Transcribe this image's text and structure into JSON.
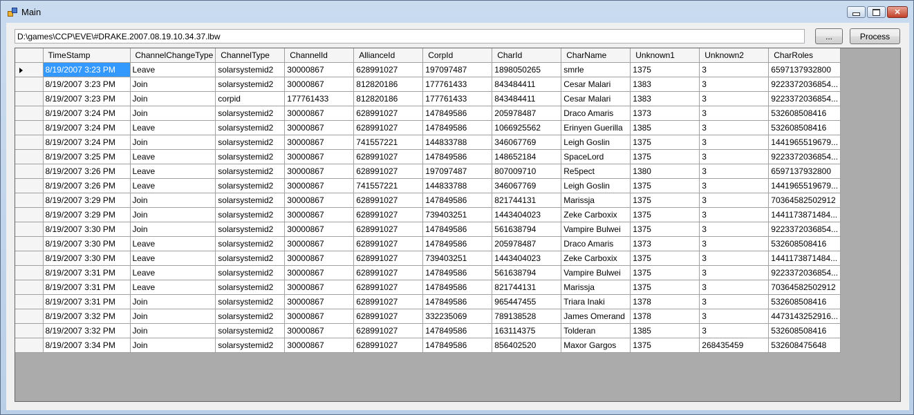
{
  "window": {
    "title": "Main"
  },
  "toolbar": {
    "path_value": "D:\\games\\CCP\\EVE\\#DRAKE.2007.08.19.10.34.37.lbw",
    "browse_label": "...",
    "process_label": "Process"
  },
  "grid": {
    "columns": [
      "TimeStamp",
      "ChannelChangeType",
      "ChannelType",
      "ChannelId",
      "AllianceId",
      "CorpId",
      "CharId",
      "CharName",
      "Unknown1",
      "Unknown2",
      "CharRoles"
    ],
    "rows": [
      [
        "8/19/2007 3:23 PM",
        "Leave",
        "solarsystemid2",
        "30000867",
        "628991027",
        "197097487",
        "1898050265",
        "smrle",
        "1375",
        "3",
        "6597137932800"
      ],
      [
        "8/19/2007 3:23 PM",
        "Join",
        "solarsystemid2",
        "30000867",
        "812820186",
        "177761433",
        "843484411",
        "Cesar Malari",
        "1383",
        "3",
        "9223372036854..."
      ],
      [
        "8/19/2007 3:23 PM",
        "Join",
        "corpid",
        "177761433",
        "812820186",
        "177761433",
        "843484411",
        "Cesar Malari",
        "1383",
        "3",
        "9223372036854..."
      ],
      [
        "8/19/2007 3:24 PM",
        "Join",
        "solarsystemid2",
        "30000867",
        "628991027",
        "147849586",
        "205978487",
        "Draco Amaris",
        "1373",
        "3",
        "532608508416"
      ],
      [
        "8/19/2007 3:24 PM",
        "Leave",
        "solarsystemid2",
        "30000867",
        "628991027",
        "147849586",
        "1066925562",
        "Erinyen Guerilla",
        "1385",
        "3",
        "532608508416"
      ],
      [
        "8/19/2007 3:24 PM",
        "Join",
        "solarsystemid2",
        "30000867",
        "741557221",
        "144833788",
        "346067769",
        "Leigh Goslin",
        "1375",
        "3",
        "1441965519679..."
      ],
      [
        "8/19/2007 3:25 PM",
        "Leave",
        "solarsystemid2",
        "30000867",
        "628991027",
        "147849586",
        "148652184",
        "SpaceLord",
        "1375",
        "3",
        "9223372036854..."
      ],
      [
        "8/19/2007 3:26 PM",
        "Leave",
        "solarsystemid2",
        "30000867",
        "628991027",
        "197097487",
        "807009710",
        "Re5pect",
        "1380",
        "3",
        "6597137932800"
      ],
      [
        "8/19/2007 3:26 PM",
        "Leave",
        "solarsystemid2",
        "30000867",
        "741557221",
        "144833788",
        "346067769",
        "Leigh Goslin",
        "1375",
        "3",
        "1441965519679..."
      ],
      [
        "8/19/2007 3:29 PM",
        "Join",
        "solarsystemid2",
        "30000867",
        "628991027",
        "147849586",
        "821744131",
        "Marissja",
        "1375",
        "3",
        "70364582502912"
      ],
      [
        "8/19/2007 3:29 PM",
        "Join",
        "solarsystemid2",
        "30000867",
        "628991027",
        "739403251",
        "1443404023",
        "Zeke Carboxix",
        "1375",
        "3",
        "1441173871484..."
      ],
      [
        "8/19/2007 3:30 PM",
        "Join",
        "solarsystemid2",
        "30000867",
        "628991027",
        "147849586",
        "561638794",
        "Vampire Bulwei",
        "1375",
        "3",
        "9223372036854..."
      ],
      [
        "8/19/2007 3:30 PM",
        "Leave",
        "solarsystemid2",
        "30000867",
        "628991027",
        "147849586",
        "205978487",
        "Draco Amaris",
        "1373",
        "3",
        "532608508416"
      ],
      [
        "8/19/2007 3:30 PM",
        "Leave",
        "solarsystemid2",
        "30000867",
        "628991027",
        "739403251",
        "1443404023",
        "Zeke Carboxix",
        "1375",
        "3",
        "1441173871484..."
      ],
      [
        "8/19/2007 3:31 PM",
        "Leave",
        "solarsystemid2",
        "30000867",
        "628991027",
        "147849586",
        "561638794",
        "Vampire Bulwei",
        "1375",
        "3",
        "9223372036854..."
      ],
      [
        "8/19/2007 3:31 PM",
        "Leave",
        "solarsystemid2",
        "30000867",
        "628991027",
        "147849586",
        "821744131",
        "Marissja",
        "1375",
        "3",
        "70364582502912"
      ],
      [
        "8/19/2007 3:31 PM",
        "Join",
        "solarsystemid2",
        "30000867",
        "628991027",
        "147849586",
        "965447455",
        "Triara Inaki",
        "1378",
        "3",
        "532608508416"
      ],
      [
        "8/19/2007 3:32 PM",
        "Join",
        "solarsystemid2",
        "30000867",
        "628991027",
        "332235069",
        "789138528",
        "James Omerand",
        "1378",
        "3",
        "4473143252916..."
      ],
      [
        "8/19/2007 3:32 PM",
        "Join",
        "solarsystemid2",
        "30000867",
        "628991027",
        "147849586",
        "163114375",
        "Tolderan",
        "1385",
        "3",
        "532608508416"
      ],
      [
        "8/19/2007 3:34 PM",
        "Join",
        "solarsystemid2",
        "30000867",
        "628991027",
        "147849586",
        "856402520",
        "Maxor Gargos",
        "1375",
        "268435459",
        "532608475648"
      ]
    ]
  }
}
